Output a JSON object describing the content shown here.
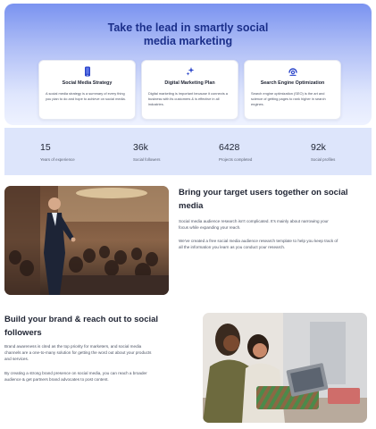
{
  "hero": {
    "title_line1": "Take the lead in smartly social",
    "title_line2": "media marketing",
    "cards": [
      {
        "icon": "phone-icon",
        "title": "Social Media Strategy",
        "description": "A social media strategy is a summary of every thing you plan to do and hope to achieve on social media."
      },
      {
        "icon": "sparkle-icon",
        "title": "Digital Marketing Plan",
        "description": "Digital marketing is important because it connects a business with its customers & is effective in all industries."
      },
      {
        "icon": "search-engine-icon",
        "title": "Search Engine Optimization",
        "description": "Search engine optimization (SEO) is the art and science of getting pages to rank higher in search engines."
      }
    ]
  },
  "stats": [
    {
      "value": "15",
      "label": "Years of experience"
    },
    {
      "value": "36k",
      "label": "Social followers"
    },
    {
      "value": "6428",
      "label": "Projects completed"
    },
    {
      "value": "92k",
      "label": "Social profiles"
    }
  ],
  "section1": {
    "title_line1": "Bring your target users together on social",
    "title_line2": "media",
    "para1_line1": "Social media audience research isn't complicated. It's mainly about narrowing your",
    "para1_line2": "focus while expanding your reach.",
    "para2_line1": "We've created a free social media audience research template to help you keep track of",
    "para2_line2": "all the information you learn as you conduct your research."
  },
  "section2": {
    "title_line1": "Build your brand & reach out to social",
    "title_line2": "followers",
    "para1_line1": "Brand awareness is cited as the top priority for marketers, and social media",
    "para1_line2": "channels are a one-to-many solution for getting the word out about your products",
    "para1_line3": "and services.",
    "para2_line1": "By creating a strong brand presence on social media, you can reach a broader",
    "para2_line2": "audience & get partners brand advocates to post content."
  },
  "colors": {
    "accent": "#1b2f8a",
    "hero_gradient_top": "#7a93f0",
    "stats_band": "#dde5fb"
  }
}
